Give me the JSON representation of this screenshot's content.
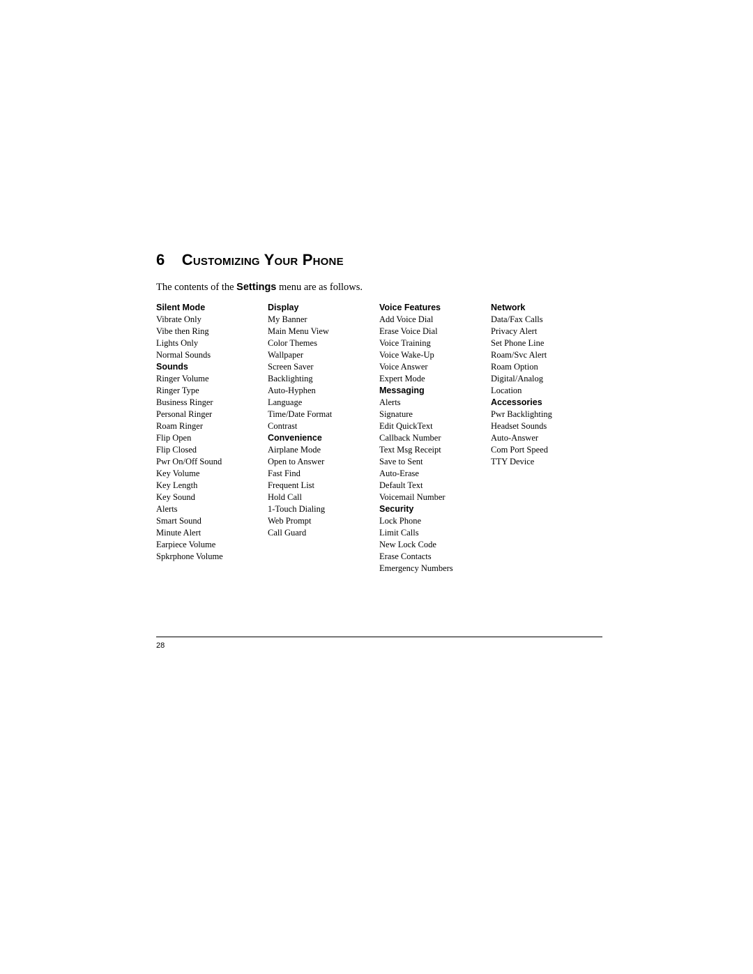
{
  "chapter": {
    "number": "6",
    "title": "Customizing Your Phone"
  },
  "intro": {
    "prefix": "The contents of the ",
    "bold": "Settings",
    "suffix": " menu are as follows."
  },
  "columns": [
    {
      "sections": [
        {
          "header": "Silent Mode",
          "items": [
            "Vibrate Only",
            "Vibe then Ring",
            "Lights Only",
            "Normal Sounds"
          ]
        },
        {
          "header": "Sounds",
          "items": [
            "Ringer Volume",
            "Ringer Type",
            "Business Ringer",
            "Personal Ringer",
            "Roam Ringer",
            "Flip Open",
            "Flip Closed",
            "Pwr On/Off Sound",
            "Key Volume",
            "Key Length",
            "Key Sound",
            "Alerts",
            "Smart Sound",
            "Minute Alert",
            "Earpiece Volume",
            "Spkrphone Volume"
          ]
        }
      ]
    },
    {
      "sections": [
        {
          "header": "Display",
          "items": [
            "My Banner",
            "Main Menu View",
            "Color Themes",
            "Wallpaper",
            "Screen Saver",
            "Backlighting",
            "Auto-Hyphen",
            "Language",
            "Time/Date Format",
            "Contrast"
          ]
        },
        {
          "header": "Convenience",
          "items": [
            "Airplane Mode",
            "Open to Answer",
            "Fast Find",
            "Frequent List",
            "Hold Call",
            "1-Touch Dialing",
            "Web Prompt",
            "Call Guard"
          ]
        }
      ]
    },
    {
      "sections": [
        {
          "header": "Voice Features",
          "items": [
            "Add Voice Dial",
            "Erase Voice Dial",
            "Voice Training",
            "Voice Wake-Up",
            "Voice Answer",
            "Expert Mode"
          ]
        },
        {
          "header": "Messaging",
          "items": [
            "Alerts",
            "Signature",
            "Edit QuickText",
            "Callback Number",
            "Text Msg Receipt",
            "Save to Sent",
            "Auto-Erase",
            "Default Text",
            "Voicemail Number"
          ]
        },
        {
          "header": "Security",
          "items": [
            "Lock Phone",
            "Limit Calls",
            "New Lock Code",
            "Erase Contacts",
            "Emergency Numbers"
          ]
        }
      ]
    },
    {
      "sections": [
        {
          "header": "Network",
          "items": [
            "Data/Fax Calls",
            "Privacy Alert",
            "Set Phone Line",
            "Roam/Svc Alert",
            "Roam Option",
            "Digital/Analog",
            "Location"
          ]
        },
        {
          "header": "Accessories",
          "items": [
            "Pwr Backlighting",
            "Headset Sounds",
            "Auto-Answer",
            "Com Port Speed",
            "TTY Device"
          ]
        }
      ]
    }
  ],
  "page_number": "28"
}
